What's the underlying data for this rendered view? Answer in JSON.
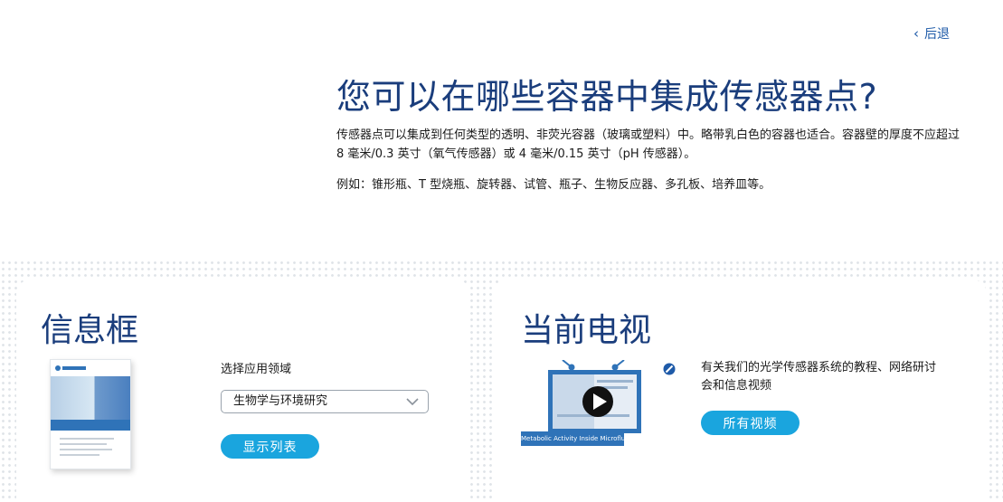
{
  "nav": {
    "back_label": "后退"
  },
  "faq": {
    "title": "您可以在哪些容器中集成传感器点?",
    "paragraph": "传感器点可以集成到任何类型的透明、非荧光容器（玻璃或塑料）中。略带乳白色的容器也适合。容器壁的厚度不应超过 8 毫米/0.3 英寸（氧气传感器）或 4 毫米/0.15 英寸（pH 传感器）。",
    "examples": "例如：锥形瓶、T 型烧瓶、旋转器、试管、瓶子、生物反应器、多孔板、培养皿等。"
  },
  "infobox": {
    "title": "信息框",
    "brochure_icon": "brochure-thumbnail",
    "select_label": "选择应用领域",
    "select_value": "生物学与环境研究",
    "button_label": "显示列表"
  },
  "tv": {
    "title": "当前电视",
    "thumbnail_icon": "video-play-icon",
    "caption": "Metabolic Activity Inside Microfluidics",
    "description": "有关我们的光学传感器系统的教程、网络研讨会和信息视频",
    "button_label": "所有视频"
  },
  "colors": {
    "heading": "#1a3d7c",
    "link": "#1e5aa8",
    "accent": "#1aa5de",
    "caption_bg": "#2f73b8"
  }
}
